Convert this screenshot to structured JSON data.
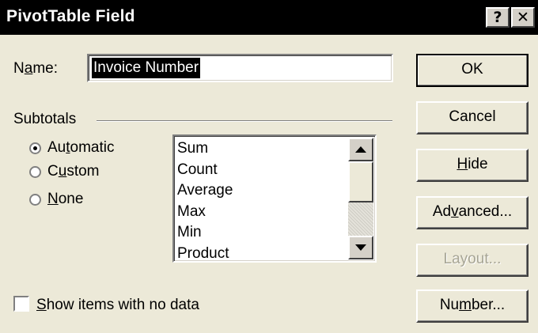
{
  "window": {
    "title": "PivotTable Field",
    "help_glyph": "?",
    "close_glyph": "✕"
  },
  "name": {
    "label_pre": "N",
    "label_u": "a",
    "label_post": "me:",
    "value": "Invoice Number"
  },
  "subtotals": {
    "group_label": "Subtotals",
    "options": [
      {
        "pre": "Au",
        "u": "t",
        "post": "omatic",
        "selected": true
      },
      {
        "pre": "C",
        "u": "u",
        "post": "stom",
        "selected": false
      },
      {
        "pre": "",
        "u": "N",
        "post": "one",
        "selected": false
      }
    ],
    "functions": [
      "Sum",
      "Count",
      "Average",
      "Max",
      "Min",
      "Product"
    ]
  },
  "buttons": {
    "ok": "OK",
    "cancel": "Cancel",
    "hide_u": "H",
    "hide_post": "ide",
    "advanced_pre": "Ad",
    "advanced_u": "v",
    "advanced_post": "anced...",
    "layout": "Layout...",
    "number_pre": "Nu",
    "number_u": "m",
    "number_post": "ber..."
  },
  "show_items": {
    "label_u": "S",
    "label_post": "how items with no data",
    "checked": false
  },
  "icons": {
    "scroll_up": "up-arrow-icon",
    "scroll_down": "down-arrow-icon"
  }
}
